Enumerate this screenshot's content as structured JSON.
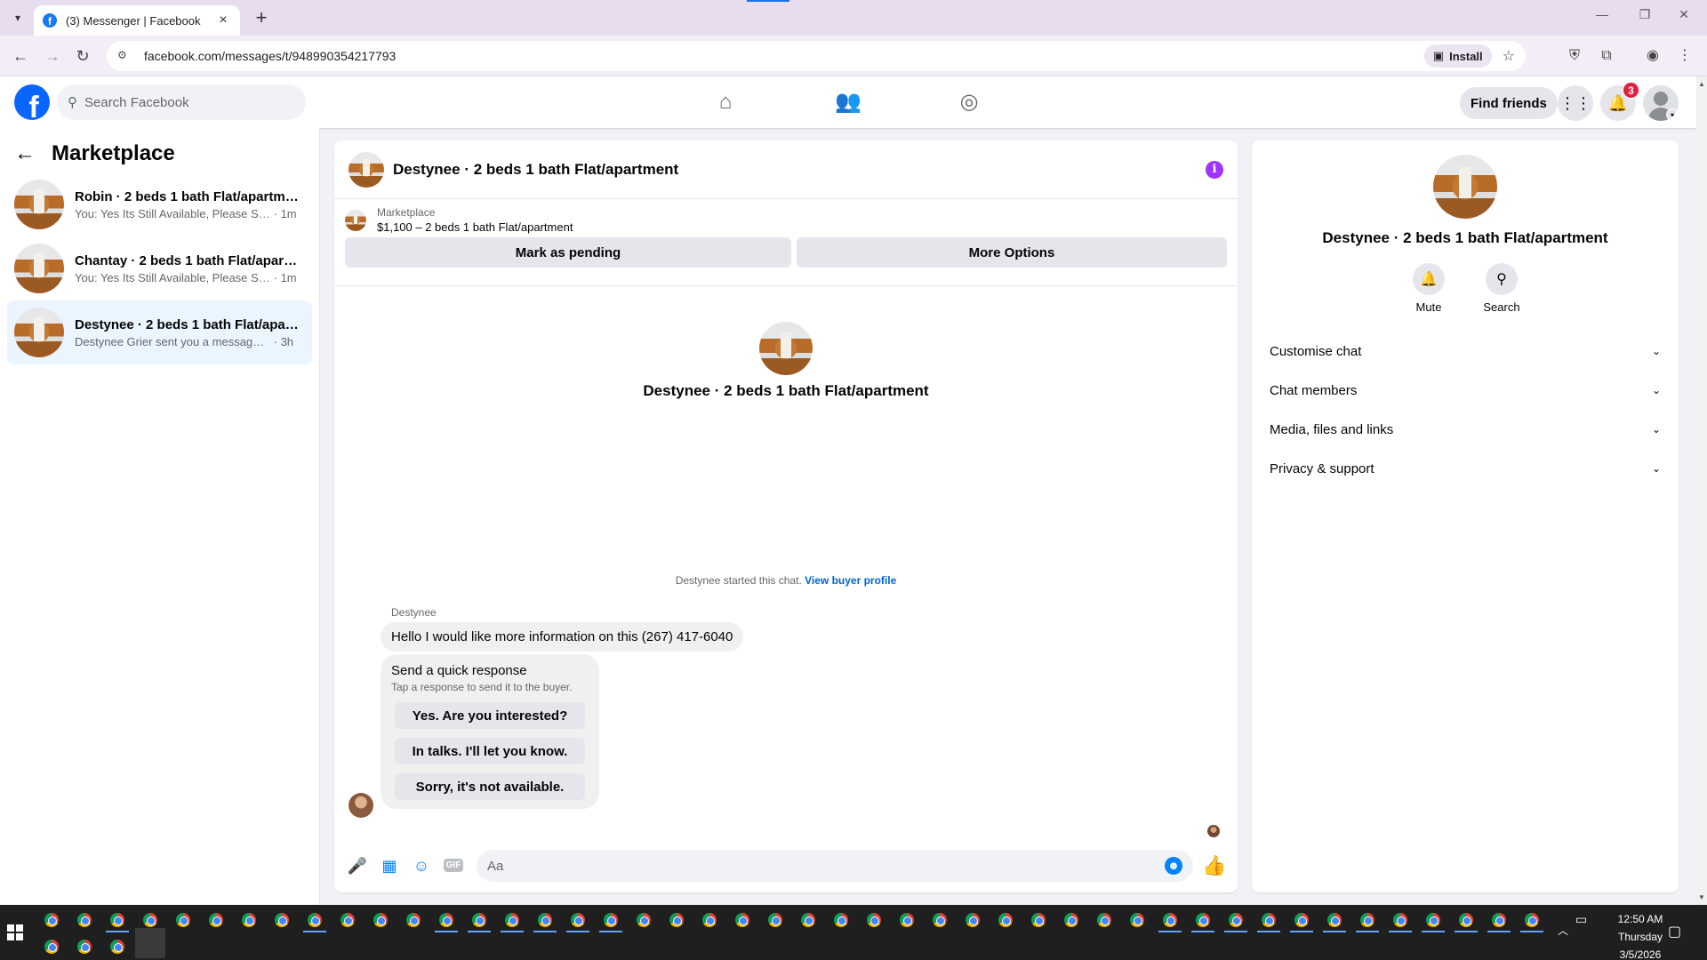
{
  "browser": {
    "tab_title": "(3) Messenger | Facebook",
    "url": "facebook.com/messages/t/948990354217793",
    "install_label": "Install"
  },
  "fb": {
    "search_placeholder": "Search Facebook",
    "find_friends": "Find friends",
    "notification_count": "3",
    "brand_color": "#0866ff"
  },
  "sidebar": {
    "title": "Marketplace",
    "conversations": [
      {
        "name": "Robin · 2 beds 1 bath Flat/apartment",
        "preview": "You: Yes Its Still Available, Please Sen...",
        "time": "· 1m",
        "active": false
      },
      {
        "name": "Chantay · 2 beds 1 bath Flat/apart...",
        "preview": "You: Yes Its Still Available, Please Sen...",
        "time": "· 1m",
        "active": false
      },
      {
        "name": "Destynee · 2 beds 1 bath Flat/apar...",
        "preview": "Destynee Grier sent you a message ab...",
        "time": "· 3h",
        "active": true
      }
    ]
  },
  "chat": {
    "title": "Destynee · 2 beds 1 bath Flat/apartment",
    "marketplace_label": "Marketplace",
    "listing": "$1,100 – 2 beds 1 bath Flat/apartment",
    "mark_pending": "Mark as pending",
    "more_options": "More Options",
    "intro_name": "Destynee · 2 beds 1 bath Flat/apartment",
    "started_text": "Destynee started this chat.",
    "view_profile": "View buyer profile",
    "sender_name": "Destynee",
    "message": "Hello I would like more information on this (267) 417-6040",
    "quick_title": "Send a quick response",
    "quick_sub": "Tap a response to send it to the buyer.",
    "quick_responses": [
      "Yes. Are you interested?",
      "In talks. I'll let you know.",
      "Sorry, it's not available."
    ],
    "composer_placeholder": "Aa"
  },
  "info": {
    "name": "Destynee · 2 beds 1 bath Flat/apartment",
    "mute": "Mute",
    "search": "Search",
    "sections": [
      "Customise chat",
      "Chat members",
      "Media, files and links",
      "Privacy & support"
    ]
  },
  "taskbar": {
    "time": "12:50 AM",
    "day": "Thursday",
    "date": "3/5/2026"
  }
}
